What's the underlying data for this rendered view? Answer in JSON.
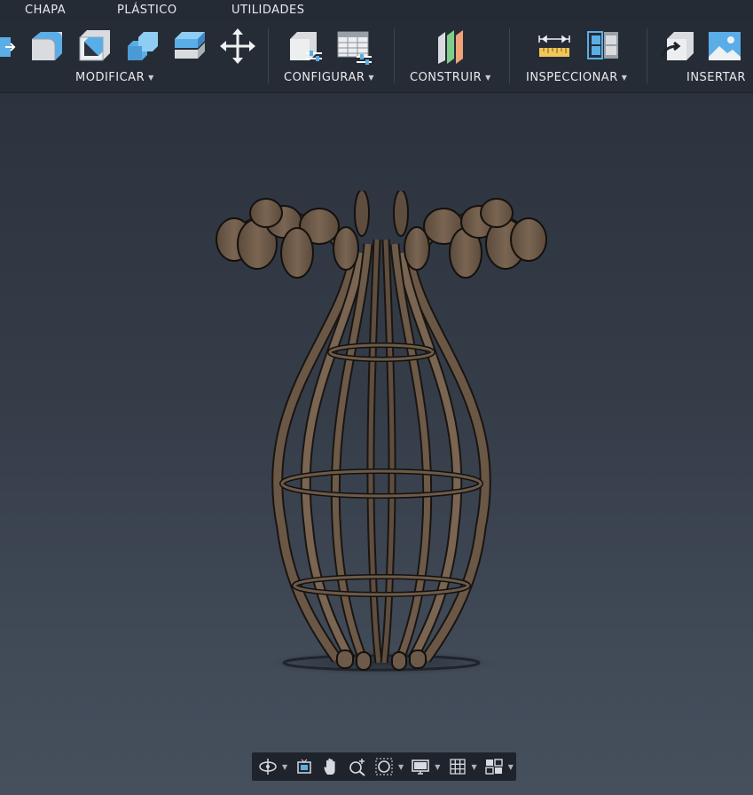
{
  "menu": {
    "tabs": [
      "CHAPA",
      "PLÁSTICO",
      "UTILIDADES"
    ]
  },
  "toolbar": {
    "groups": [
      {
        "label": "MODIFICAR",
        "tools": [
          "press-pull-icon",
          "fillet-icon",
          "shell-icon",
          "combine-icon",
          "offset-face-icon",
          "move-icon"
        ]
      },
      {
        "label": "CONFIGURAR",
        "tools": [
          "change-parameters-icon",
          "parameter-table-icon"
        ]
      },
      {
        "label": "CONSTRUIR",
        "tools": [
          "offset-plane-icon"
        ]
      },
      {
        "label": "INSPECCIONAR",
        "tools": [
          "measure-icon",
          "section-analysis-icon"
        ]
      },
      {
        "label": "INSERTAR",
        "tools": [
          "insert-derive-icon",
          "insert-canvas-icon"
        ]
      }
    ]
  },
  "viewport": {
    "model": "wooden-vase-lamp-model"
  },
  "navbar": {
    "buttons": [
      "orbit-icon",
      "look-at-icon",
      "pan-icon",
      "zoom-icon",
      "fit-window-icon",
      "display-settings-icon",
      "grid-icon",
      "viewports-icon"
    ]
  },
  "colors": {
    "toolbar_bg": "#262c35",
    "viewport_top": "#2c333e",
    "viewport_bottom": "#46505d",
    "wood": "#6d5a48",
    "accent_blue": "#5aaee8"
  }
}
